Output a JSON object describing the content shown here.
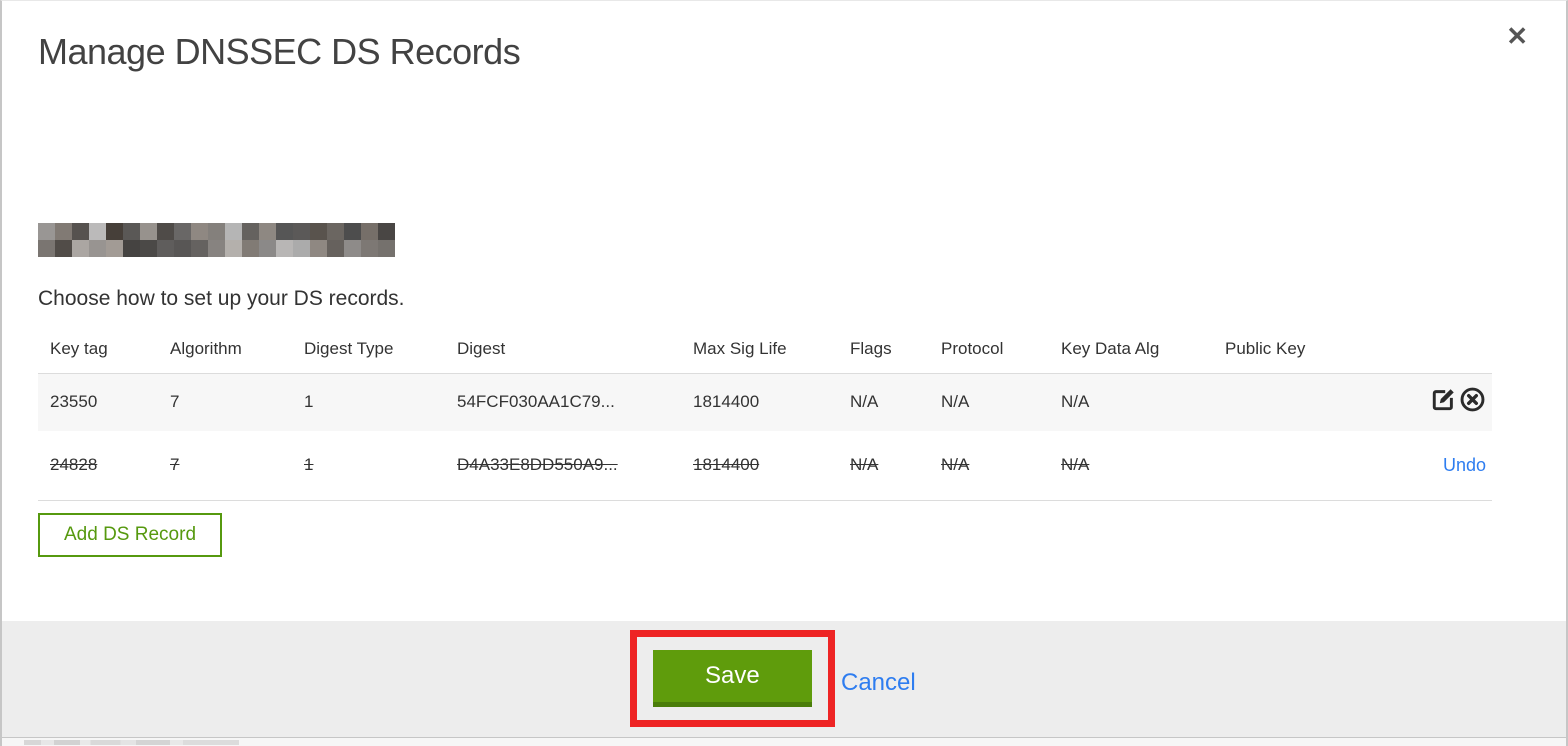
{
  "modal": {
    "title": "Manage DNSSEC DS Records",
    "close_glyph": "✕",
    "domain": {
      "redacted": true
    },
    "instruction": "Choose how to set up your DS records."
  },
  "table": {
    "columns": [
      "Key tag",
      "Algorithm",
      "Digest Type",
      "Digest",
      "Max Sig Life",
      "Flags",
      "Protocol",
      "Key Data Alg",
      "Public Key"
    ],
    "rows": [
      {
        "key_tag": "23550",
        "algorithm": "7",
        "digest_type": "1",
        "digest": "54FCF030AA1C79...",
        "max_sig_life": "1814400",
        "flags": "N/A",
        "protocol": "N/A",
        "key_data_alg": "N/A",
        "public_key": "",
        "state": "active",
        "actions": [
          "edit",
          "delete"
        ]
      },
      {
        "key_tag": "24828",
        "algorithm": "7",
        "digest_type": "1",
        "digest": "D4A33E8DD550A9...",
        "max_sig_life": "1814400",
        "flags": "N/A",
        "protocol": "N/A",
        "key_data_alg": "N/A",
        "public_key": "",
        "state": "pending-delete",
        "undo_label": "Undo"
      }
    ]
  },
  "buttons": {
    "add_ds_record": "Add DS Record",
    "save": "Save",
    "cancel": "Cancel"
  },
  "colors": {
    "green_button": "#5f9c0c",
    "green_button_shadow": "#4a7d0a",
    "green_outline": "#56990f",
    "link_blue": "#2e7df0",
    "annotation_red": "#ee2424",
    "footer_gray": "#ededed",
    "row_gray": "#f7f7f7"
  }
}
